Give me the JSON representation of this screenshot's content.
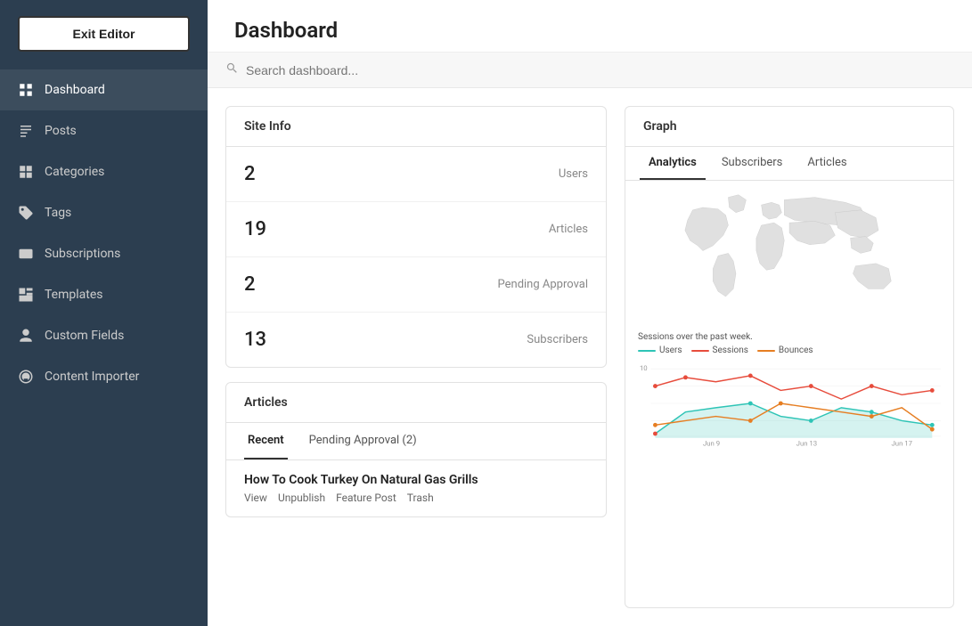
{
  "sidebar": {
    "exit_button": "Exit Editor",
    "items": [
      {
        "id": "dashboard",
        "label": "Dashboard",
        "icon": "dashboard-icon",
        "active": true
      },
      {
        "id": "posts",
        "label": "Posts",
        "icon": "posts-icon",
        "active": false
      },
      {
        "id": "categories",
        "label": "Categories",
        "icon": "categories-icon",
        "active": false
      },
      {
        "id": "tags",
        "label": "Tags",
        "icon": "tags-icon",
        "active": false
      },
      {
        "id": "subscriptions",
        "label": "Subscriptions",
        "icon": "subscriptions-icon",
        "active": false
      },
      {
        "id": "templates",
        "label": "Templates",
        "icon": "templates-icon",
        "active": false
      },
      {
        "id": "custom-fields",
        "label": "Custom Fields",
        "icon": "custom-fields-icon",
        "active": false
      },
      {
        "id": "content-importer",
        "label": "Content Importer",
        "icon": "content-importer-icon",
        "active": false
      }
    ]
  },
  "header": {
    "title": "Dashboard"
  },
  "search": {
    "placeholder": "Search dashboard..."
  },
  "site_info": {
    "title": "Site Info",
    "stats": [
      {
        "value": "2",
        "label": "Users"
      },
      {
        "value": "19",
        "label": "Articles"
      },
      {
        "value": "2",
        "label": "Pending Approval"
      },
      {
        "value": "13",
        "label": "Subscribers"
      }
    ]
  },
  "articles": {
    "title": "Articles",
    "tabs": [
      {
        "label": "Recent",
        "active": true
      },
      {
        "label": "Pending Approval (2)",
        "active": false
      }
    ],
    "items": [
      {
        "title": "How To Cook Turkey On Natural Gas Grills",
        "actions": [
          "View",
          "Unpublish",
          "Feature Post",
          "Trash"
        ]
      }
    ]
  },
  "graph": {
    "title": "Graph",
    "tabs": [
      {
        "label": "Analytics",
        "active": true
      },
      {
        "label": "Subscribers",
        "active": false
      },
      {
        "label": "Articles",
        "active": false
      }
    ],
    "chart_label": "Sessions over the past week.",
    "legend": [
      {
        "label": "Users",
        "color": "#2ec4b6"
      },
      {
        "label": "Sessions",
        "color": "#e74c3c"
      },
      {
        "label": "Bounces",
        "color": "#e67e22"
      }
    ],
    "x_labels": [
      "Jun 9",
      "Jun 13",
      "Jun 17"
    ],
    "y_max": "10"
  }
}
